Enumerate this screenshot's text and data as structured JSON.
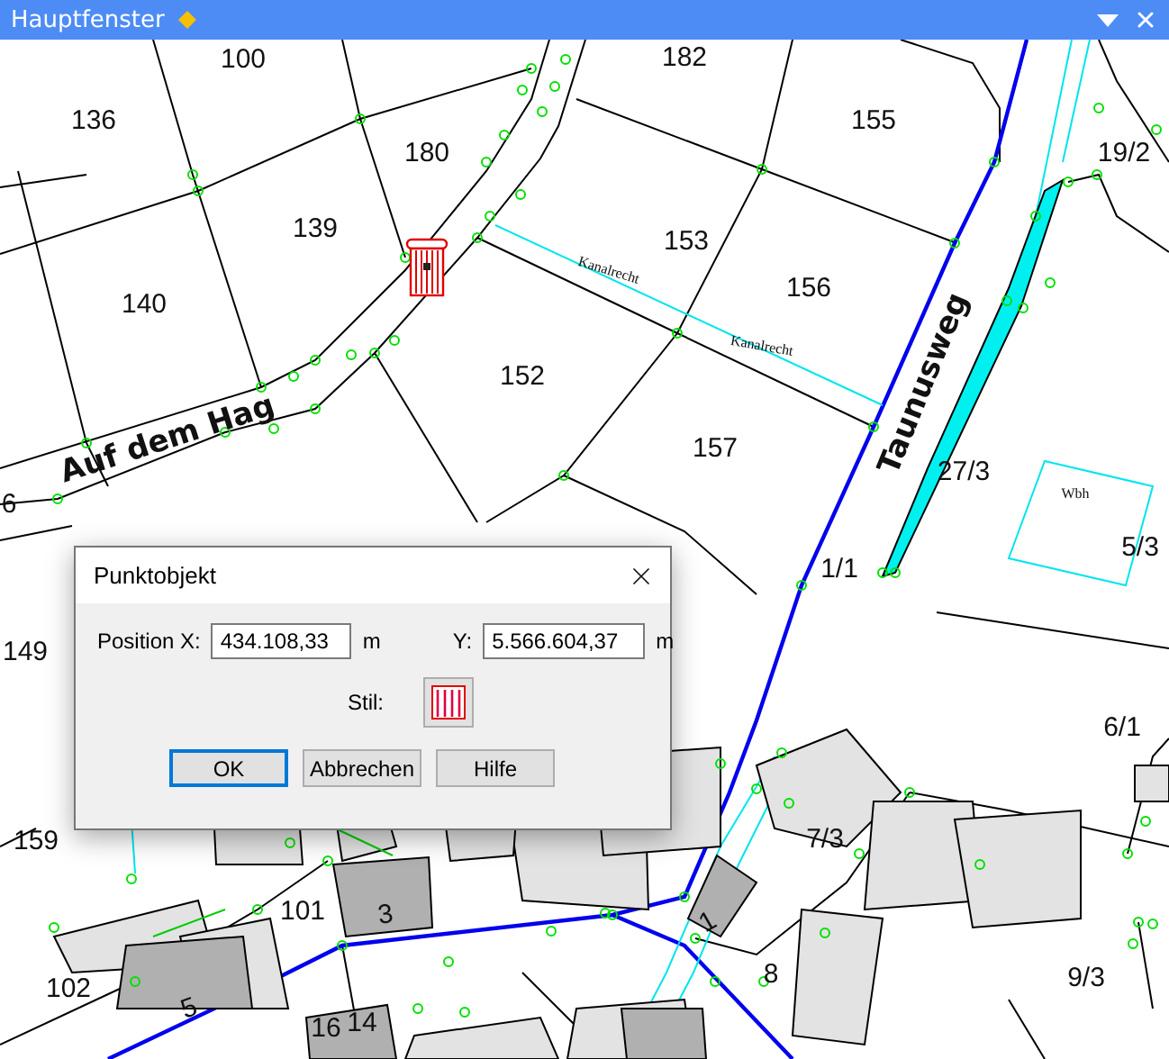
{
  "window": {
    "title": "Hauptfenster"
  },
  "map": {
    "parcel_labels": [
      {
        "text": "100"
      },
      {
        "text": "136"
      },
      {
        "text": "180"
      },
      {
        "text": "182"
      },
      {
        "text": "155"
      },
      {
        "text": "139"
      },
      {
        "text": "153"
      },
      {
        "text": "156"
      },
      {
        "text": "140"
      },
      {
        "text": "152"
      },
      {
        "text": "157"
      },
      {
        "text": "6"
      },
      {
        "text": "149"
      },
      {
        "text": "159"
      },
      {
        "text": "101"
      },
      {
        "text": "3"
      },
      {
        "text": "102"
      },
      {
        "text": "5"
      },
      {
        "text": "16"
      },
      {
        "text": "14"
      },
      {
        "text": "1"
      },
      {
        "text": "8"
      },
      {
        "text": "7/3"
      },
      {
        "text": "9/3"
      },
      {
        "text": "6/1"
      },
      {
        "text": "1/1"
      },
      {
        "text": "27/3"
      },
      {
        "text": "5/3"
      },
      {
        "text": "19/2"
      }
    ],
    "street_labels": [
      {
        "text": "Auf dem Hag"
      },
      {
        "text": "Taunusweg"
      }
    ],
    "annotations": [
      {
        "text": "Kanalrecht"
      },
      {
        "text": "Kanalrecht"
      },
      {
        "text": "Wbh"
      }
    ]
  },
  "dialog": {
    "title": "Punktobjekt",
    "fields": [
      {
        "label": "Position X:",
        "value": "434.108,33",
        "unit": "m"
      },
      {
        "label": "Y:",
        "value": "5.566.604,37",
        "unit": "m"
      }
    ],
    "style_label": "Stil:",
    "buttons": [
      {
        "label": "OK",
        "default": true
      },
      {
        "label": "Abbrechen",
        "default": false
      },
      {
        "label": "Hilfe",
        "default": false
      }
    ]
  }
}
